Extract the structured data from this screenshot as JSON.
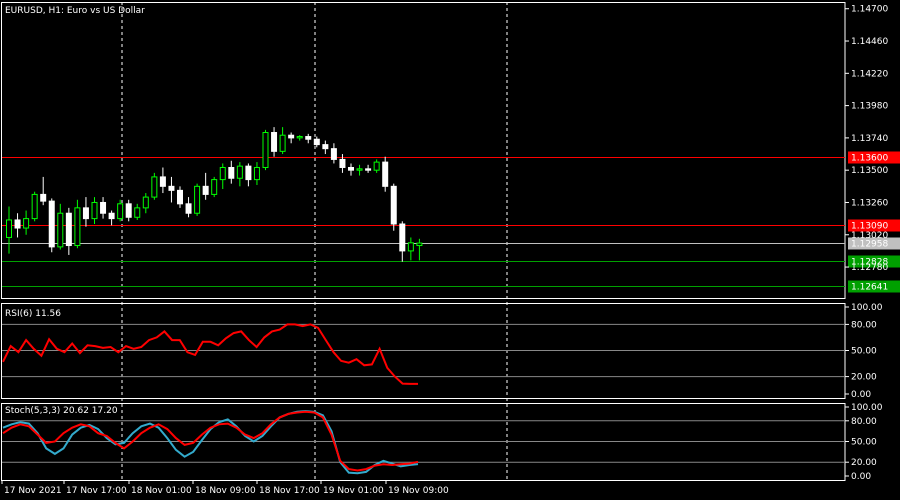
{
  "chart_data": {
    "type": "candlestick",
    "title": "EURUSD, H1:  Euro vs US Dollar",
    "symbol": "EURUSD",
    "timeframe": "H1",
    "description": "Euro vs US Dollar",
    "colors": {
      "background": "#000000",
      "bull_candle": "#00ff00",
      "bear_candle": "#ffffff",
      "rsi_line": "#ff0000",
      "stoch_main": "#ff0000",
      "stoch_signal": "#33aacc",
      "red_level": "#ff0000",
      "green_level": "#00a000",
      "current_price": "#c0c0c0",
      "grid": "#ffffff"
    },
    "price_axis": {
      "ylim": [
        1.1255,
        1.1475
      ],
      "ticks": [
        "1.14700",
        "1.14460",
        "1.14220",
        "1.13980",
        "1.13740",
        "1.13500",
        "1.13260",
        "1.13020",
        "1.12780"
      ]
    },
    "time_axis": {
      "labels": [
        "17 Nov 2021",
        "17 Nov 17:00",
        "18 Nov 01:00",
        "18 Nov 09:00",
        "18 Nov 17:00",
        "19 Nov 01:00",
        "19 Nov 09:00"
      ]
    },
    "price_levels": [
      {
        "label": "1.13600",
        "value": 1.136,
        "color": "#ff0000",
        "tag_bg": "#ff0000"
      },
      {
        "label": "1.13090",
        "value": 1.1309,
        "color": "#ff0000",
        "tag_bg": "#ff0000"
      },
      {
        "label": "1.12958",
        "value": 1.12958,
        "color": "#c0c0c0",
        "tag_bg": "#c0c0c0"
      },
      {
        "label": "1.12828",
        "value": 1.12828,
        "color": "#00a000",
        "tag_bg": "#00a000"
      },
      {
        "label": "1.12641",
        "value": 1.12641,
        "color": "#00a000",
        "tag_bg": "#00a000"
      }
    ],
    "candles": [
      [
        1.13,
        1.1323,
        1.1288,
        1.1313
      ],
      [
        1.1313,
        1.1318,
        1.13,
        1.1307
      ],
      [
        1.1307,
        1.132,
        1.1302,
        1.1314
      ],
      [
        1.1314,
        1.1334,
        1.1312,
        1.1332
      ],
      [
        1.1332,
        1.1345,
        1.1324,
        1.1327
      ],
      [
        1.1327,
        1.1329,
        1.1289,
        1.1293
      ],
      [
        1.1293,
        1.1325,
        1.1291,
        1.1318
      ],
      [
        1.1318,
        1.1322,
        1.1287,
        1.1294
      ],
      [
        1.1294,
        1.1328,
        1.1292,
        1.1322
      ],
      [
        1.1322,
        1.133,
        1.1308,
        1.1314
      ],
      [
        1.1314,
        1.133,
        1.131,
        1.1326
      ],
      [
        1.1326,
        1.133,
        1.1314,
        1.1318
      ],
      [
        1.1318,
        1.132,
        1.1309,
        1.1314
      ],
      [
        1.1314,
        1.1328,
        1.1312,
        1.1325
      ],
      [
        1.1325,
        1.1328,
        1.1312,
        1.1315
      ],
      [
        1.1315,
        1.1325,
        1.1313,
        1.1322
      ],
      [
        1.1322,
        1.1333,
        1.1318,
        1.133
      ],
      [
        1.133,
        1.1348,
        1.1328,
        1.1345
      ],
      [
        1.1345,
        1.1352,
        1.1333,
        1.1338
      ],
      [
        1.1338,
        1.1345,
        1.1326,
        1.1335
      ],
      [
        1.1335,
        1.1338,
        1.1322,
        1.1325
      ],
      [
        1.1325,
        1.133,
        1.1315,
        1.1318
      ],
      [
        1.1318,
        1.134,
        1.1316,
        1.1338
      ],
      [
        1.1338,
        1.1348,
        1.1328,
        1.1332
      ],
      [
        1.1332,
        1.1345,
        1.133,
        1.1343
      ],
      [
        1.1343,
        1.1355,
        1.1336,
        1.1352
      ],
      [
        1.1352,
        1.1357,
        1.134,
        1.1344
      ],
      [
        1.1344,
        1.1356,
        1.1338,
        1.1353
      ],
      [
        1.1353,
        1.1355,
        1.1338,
        1.1343
      ],
      [
        1.1343,
        1.1356,
        1.1339,
        1.1352
      ],
      [
        1.1352,
        1.138,
        1.135,
        1.1378
      ],
      [
        1.1378,
        1.1382,
        1.136,
        1.1364
      ],
      [
        1.1364,
        1.1382,
        1.1362,
        1.1376
      ],
      [
        1.1376,
        1.1378,
        1.137,
        1.1374
      ],
      [
        1.1374,
        1.1376,
        1.1372,
        1.1375
      ],
      [
        1.1375,
        1.1377,
        1.137,
        1.1373
      ],
      [
        1.1373,
        1.1375,
        1.1367,
        1.1369
      ],
      [
        1.1369,
        1.1372,
        1.1362,
        1.1366
      ],
      [
        1.1366,
        1.137,
        1.1355,
        1.1358
      ],
      [
        1.1358,
        1.1362,
        1.1348,
        1.1352
      ],
      [
        1.1352,
        1.1355,
        1.1346,
        1.135
      ],
      [
        1.135,
        1.1354,
        1.1346,
        1.1351
      ],
      [
        1.1351,
        1.1354,
        1.1348,
        1.135
      ],
      [
        1.135,
        1.1358,
        1.1348,
        1.1356
      ],
      [
        1.1356,
        1.136,
        1.1334,
        1.1338
      ],
      [
        1.1338,
        1.134,
        1.1305,
        1.131
      ],
      [
        1.131,
        1.1312,
        1.1282,
        1.129
      ],
      [
        1.129,
        1.13,
        1.1283,
        1.1296
      ],
      [
        1.1294,
        1.1299,
        1.1283,
        1.12958
      ]
    ],
    "rsi": {
      "label": "RSI(6) 11.56",
      "ylim": [
        0,
        100
      ],
      "levels": [
        80,
        50,
        20
      ],
      "ticks": [
        "100.00",
        "80.00",
        "50.00",
        "20.00",
        "0.00"
      ],
      "values": [
        37,
        55,
        48,
        62,
        52,
        44,
        63,
        52,
        48,
        58,
        47,
        56,
        55,
        53,
        54,
        48,
        55,
        52,
        54,
        62,
        65,
        72,
        62,
        62,
        48,
        45,
        60,
        60,
        56,
        64,
        70,
        72,
        62,
        54,
        65,
        72,
        74,
        80,
        80,
        78,
        80,
        76,
        62,
        48,
        38,
        36,
        40,
        33,
        34,
        52,
        30,
        20,
        12,
        11.56,
        11.56
      ]
    },
    "stoch": {
      "label": "Stoch(5,3,3) 20.62 17.20",
      "ylim": [
        0,
        100
      ],
      "levels": [
        80,
        50,
        20
      ],
      "ticks": [
        "100.00",
        "80.00",
        "50.00",
        "20.00",
        "0.00"
      ],
      "main": [
        62,
        70,
        75,
        72,
        60,
        48,
        50,
        62,
        70,
        75,
        72,
        62,
        58,
        48,
        40,
        50,
        62,
        70,
        75,
        68,
        55,
        45,
        48,
        60,
        70,
        75,
        76,
        70,
        60,
        55,
        62,
        75,
        85,
        90,
        92,
        93,
        92,
        85,
        60,
        22,
        10,
        8,
        10,
        15,
        17,
        16,
        17,
        18,
        20.62
      ],
      "signal": [
        70,
        75,
        78,
        76,
        62,
        40,
        32,
        40,
        60,
        70,
        74,
        68,
        55,
        46,
        48,
        62,
        72,
        76,
        70,
        55,
        38,
        28,
        35,
        52,
        68,
        78,
        82,
        72,
        58,
        50,
        58,
        72,
        85,
        90,
        93,
        94,
        93,
        88,
        65,
        20,
        5,
        4,
        6,
        16,
        22,
        18,
        14,
        16,
        17.2
      ]
    }
  }
}
